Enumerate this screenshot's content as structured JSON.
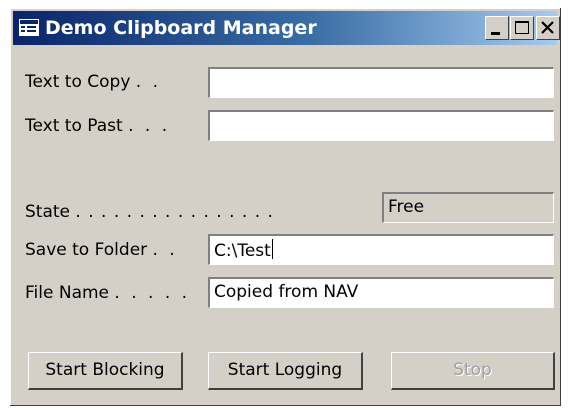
{
  "window": {
    "title": "Demo Clipboard Manager",
    "icon": "form-icon",
    "controls": [
      "minimize-icon",
      "maximize-icon",
      "close-icon"
    ]
  },
  "fields": {
    "text_to_copy": {
      "label": "Text to Copy",
      "leader": ". .",
      "value": ""
    },
    "text_to_past": {
      "label": "Text to Past",
      "leader": ". . .",
      "value": ""
    },
    "state": {
      "label": "State",
      "leader": ". . . . . . . . . . . . . . . .",
      "value": "Free"
    },
    "save_to_folder": {
      "label": "Save to Folder",
      "leader": ". .",
      "value": "C:\\Test"
    },
    "file_name": {
      "label": "File Name",
      "leader": ". . . . .",
      "value": "Copied from NAV"
    }
  },
  "buttons": {
    "start_blocking": "Start Blocking",
    "start_logging": "Start Logging",
    "stop": "Stop"
  },
  "colors": {
    "face": "#d4d0c8",
    "title_start": "#0a246a",
    "title_end": "#a6caf0",
    "disabled_text": "#a0a0a0"
  }
}
